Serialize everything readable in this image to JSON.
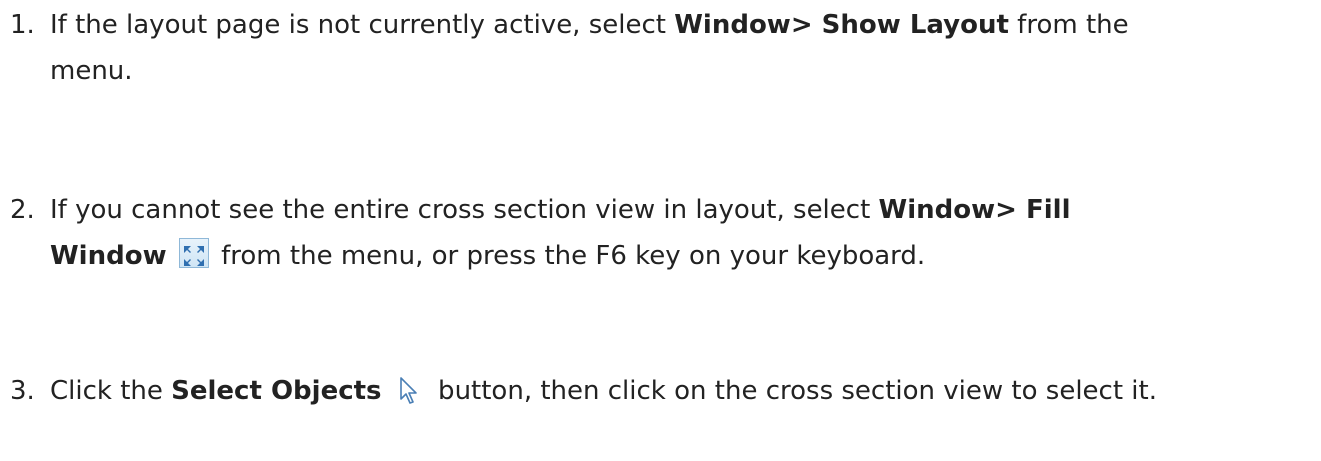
{
  "steps": [
    {
      "number": "1.",
      "t1": "If the layout page is not currently active, select ",
      "b1": "Window> Show Layout",
      "t2": " from the",
      "t3": "menu."
    },
    {
      "number": "2.",
      "t1": "If you cannot see the entire cross section view in layout, select ",
      "b1": "Window> Fill",
      "b2": "Window",
      "t2": " from the menu, or press the F6 key on your keyboard.",
      "icon": "fill-window-icon"
    },
    {
      "number": "3.",
      "t1": "Click the ",
      "b1": "Select Objects",
      "t2": " button, then click on the cross section view to select it.",
      "icon": "select-objects-cursor-icon"
    }
  ],
  "colors": {
    "text": "#222222",
    "icon_blue": "#2f6fb0",
    "icon_bg": "#dcecf8"
  }
}
